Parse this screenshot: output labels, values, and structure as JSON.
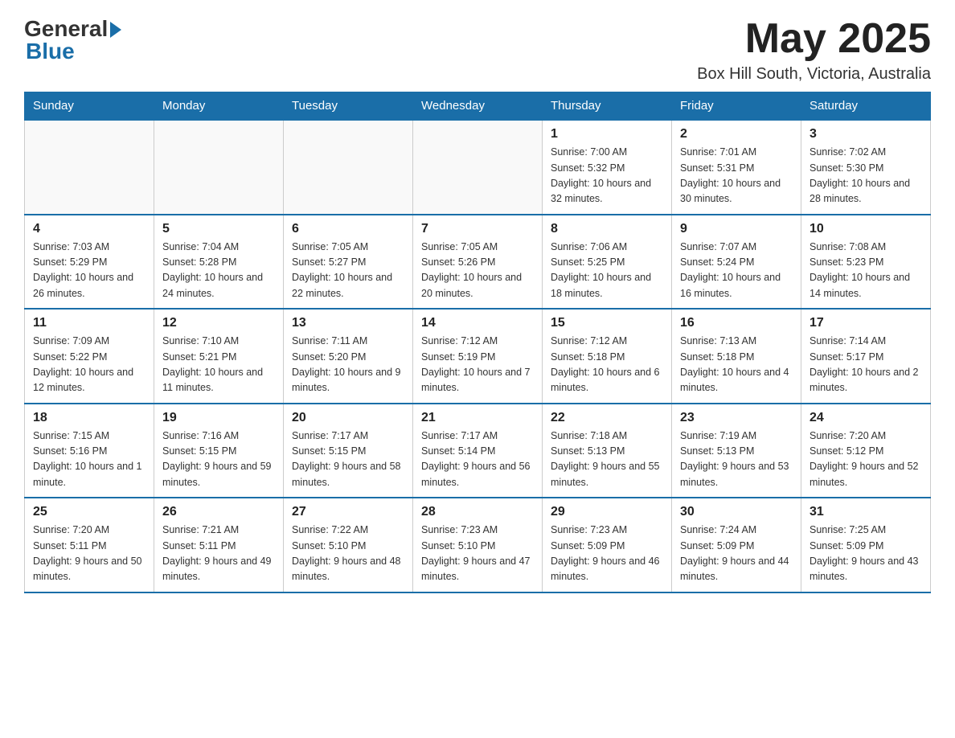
{
  "header": {
    "logo_general": "General",
    "logo_blue": "Blue",
    "month_year": "May 2025",
    "location": "Box Hill South, Victoria, Australia"
  },
  "weekdays": [
    "Sunday",
    "Monday",
    "Tuesday",
    "Wednesday",
    "Thursday",
    "Friday",
    "Saturday"
  ],
  "weeks": [
    [
      {
        "day": "",
        "info": ""
      },
      {
        "day": "",
        "info": ""
      },
      {
        "day": "",
        "info": ""
      },
      {
        "day": "",
        "info": ""
      },
      {
        "day": "1",
        "info": "Sunrise: 7:00 AM\nSunset: 5:32 PM\nDaylight: 10 hours and 32 minutes."
      },
      {
        "day": "2",
        "info": "Sunrise: 7:01 AM\nSunset: 5:31 PM\nDaylight: 10 hours and 30 minutes."
      },
      {
        "day": "3",
        "info": "Sunrise: 7:02 AM\nSunset: 5:30 PM\nDaylight: 10 hours and 28 minutes."
      }
    ],
    [
      {
        "day": "4",
        "info": "Sunrise: 7:03 AM\nSunset: 5:29 PM\nDaylight: 10 hours and 26 minutes."
      },
      {
        "day": "5",
        "info": "Sunrise: 7:04 AM\nSunset: 5:28 PM\nDaylight: 10 hours and 24 minutes."
      },
      {
        "day": "6",
        "info": "Sunrise: 7:05 AM\nSunset: 5:27 PM\nDaylight: 10 hours and 22 minutes."
      },
      {
        "day": "7",
        "info": "Sunrise: 7:05 AM\nSunset: 5:26 PM\nDaylight: 10 hours and 20 minutes."
      },
      {
        "day": "8",
        "info": "Sunrise: 7:06 AM\nSunset: 5:25 PM\nDaylight: 10 hours and 18 minutes."
      },
      {
        "day": "9",
        "info": "Sunrise: 7:07 AM\nSunset: 5:24 PM\nDaylight: 10 hours and 16 minutes."
      },
      {
        "day": "10",
        "info": "Sunrise: 7:08 AM\nSunset: 5:23 PM\nDaylight: 10 hours and 14 minutes."
      }
    ],
    [
      {
        "day": "11",
        "info": "Sunrise: 7:09 AM\nSunset: 5:22 PM\nDaylight: 10 hours and 12 minutes."
      },
      {
        "day": "12",
        "info": "Sunrise: 7:10 AM\nSunset: 5:21 PM\nDaylight: 10 hours and 11 minutes."
      },
      {
        "day": "13",
        "info": "Sunrise: 7:11 AM\nSunset: 5:20 PM\nDaylight: 10 hours and 9 minutes."
      },
      {
        "day": "14",
        "info": "Sunrise: 7:12 AM\nSunset: 5:19 PM\nDaylight: 10 hours and 7 minutes."
      },
      {
        "day": "15",
        "info": "Sunrise: 7:12 AM\nSunset: 5:18 PM\nDaylight: 10 hours and 6 minutes."
      },
      {
        "day": "16",
        "info": "Sunrise: 7:13 AM\nSunset: 5:18 PM\nDaylight: 10 hours and 4 minutes."
      },
      {
        "day": "17",
        "info": "Sunrise: 7:14 AM\nSunset: 5:17 PM\nDaylight: 10 hours and 2 minutes."
      }
    ],
    [
      {
        "day": "18",
        "info": "Sunrise: 7:15 AM\nSunset: 5:16 PM\nDaylight: 10 hours and 1 minute."
      },
      {
        "day": "19",
        "info": "Sunrise: 7:16 AM\nSunset: 5:15 PM\nDaylight: 9 hours and 59 minutes."
      },
      {
        "day": "20",
        "info": "Sunrise: 7:17 AM\nSunset: 5:15 PM\nDaylight: 9 hours and 58 minutes."
      },
      {
        "day": "21",
        "info": "Sunrise: 7:17 AM\nSunset: 5:14 PM\nDaylight: 9 hours and 56 minutes."
      },
      {
        "day": "22",
        "info": "Sunrise: 7:18 AM\nSunset: 5:13 PM\nDaylight: 9 hours and 55 minutes."
      },
      {
        "day": "23",
        "info": "Sunrise: 7:19 AM\nSunset: 5:13 PM\nDaylight: 9 hours and 53 minutes."
      },
      {
        "day": "24",
        "info": "Sunrise: 7:20 AM\nSunset: 5:12 PM\nDaylight: 9 hours and 52 minutes."
      }
    ],
    [
      {
        "day": "25",
        "info": "Sunrise: 7:20 AM\nSunset: 5:11 PM\nDaylight: 9 hours and 50 minutes."
      },
      {
        "day": "26",
        "info": "Sunrise: 7:21 AM\nSunset: 5:11 PM\nDaylight: 9 hours and 49 minutes."
      },
      {
        "day": "27",
        "info": "Sunrise: 7:22 AM\nSunset: 5:10 PM\nDaylight: 9 hours and 48 minutes."
      },
      {
        "day": "28",
        "info": "Sunrise: 7:23 AM\nSunset: 5:10 PM\nDaylight: 9 hours and 47 minutes."
      },
      {
        "day": "29",
        "info": "Sunrise: 7:23 AM\nSunset: 5:09 PM\nDaylight: 9 hours and 46 minutes."
      },
      {
        "day": "30",
        "info": "Sunrise: 7:24 AM\nSunset: 5:09 PM\nDaylight: 9 hours and 44 minutes."
      },
      {
        "day": "31",
        "info": "Sunrise: 7:25 AM\nSunset: 5:09 PM\nDaylight: 9 hours and 43 minutes."
      }
    ]
  ]
}
